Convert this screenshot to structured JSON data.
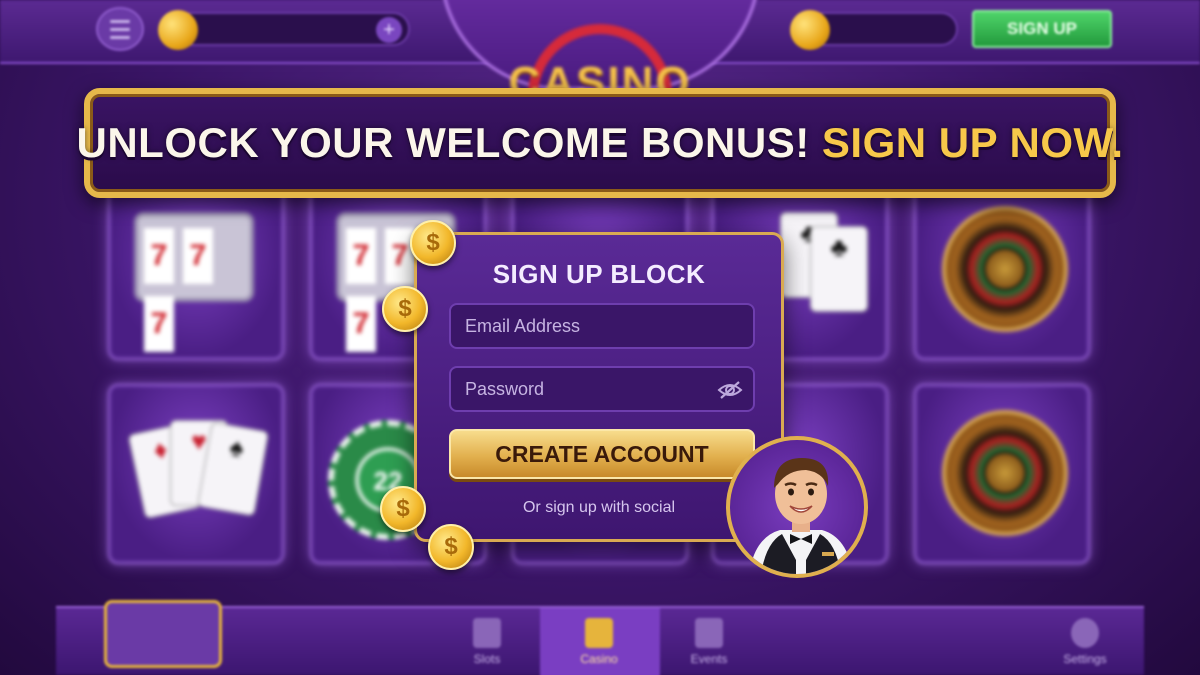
{
  "top_bar": {
    "signup_label": "SIGN UP",
    "plus_label": "+"
  },
  "logo": {
    "text": "CASINO"
  },
  "banner": {
    "text_main": "UNLOCK YOUR WELCOME BONUS! ",
    "text_accent": "SIGN UP NOW."
  },
  "signup_card": {
    "title": "SIGN UP BLOCK",
    "email_placeholder": "Email Address",
    "password_placeholder": "Password",
    "create_label": "CREATE ACCOUNT",
    "social_text": "Or sign up with social"
  },
  "games": [
    {
      "type": "slot",
      "symbols": [
        "7",
        "7",
        "7"
      ]
    },
    {
      "type": "slot",
      "symbols": [
        "7",
        "7",
        "7"
      ]
    },
    {
      "type": "unknown"
    },
    {
      "type": "cards"
    },
    {
      "type": "roulette"
    },
    {
      "type": "cards"
    },
    {
      "type": "chip",
      "value": "22"
    },
    {
      "type": "unknown"
    },
    {
      "type": "unknown"
    },
    {
      "type": "roulette"
    }
  ],
  "bottom_nav": [
    {
      "label": "Slots",
      "icon": "cards-icon",
      "active": false
    },
    {
      "label": "Casino",
      "icon": "crown-icon",
      "active": true
    },
    {
      "label": "Events",
      "icon": "trophy-icon",
      "active": false
    },
    {
      "label": "Settings",
      "icon": "gear-icon",
      "active": false
    }
  ],
  "colors": {
    "accent_gold": "#e6b84a",
    "banner_accent": "#f7c84a",
    "signup_green": "#229a3c",
    "purple": "#3e1670"
  }
}
